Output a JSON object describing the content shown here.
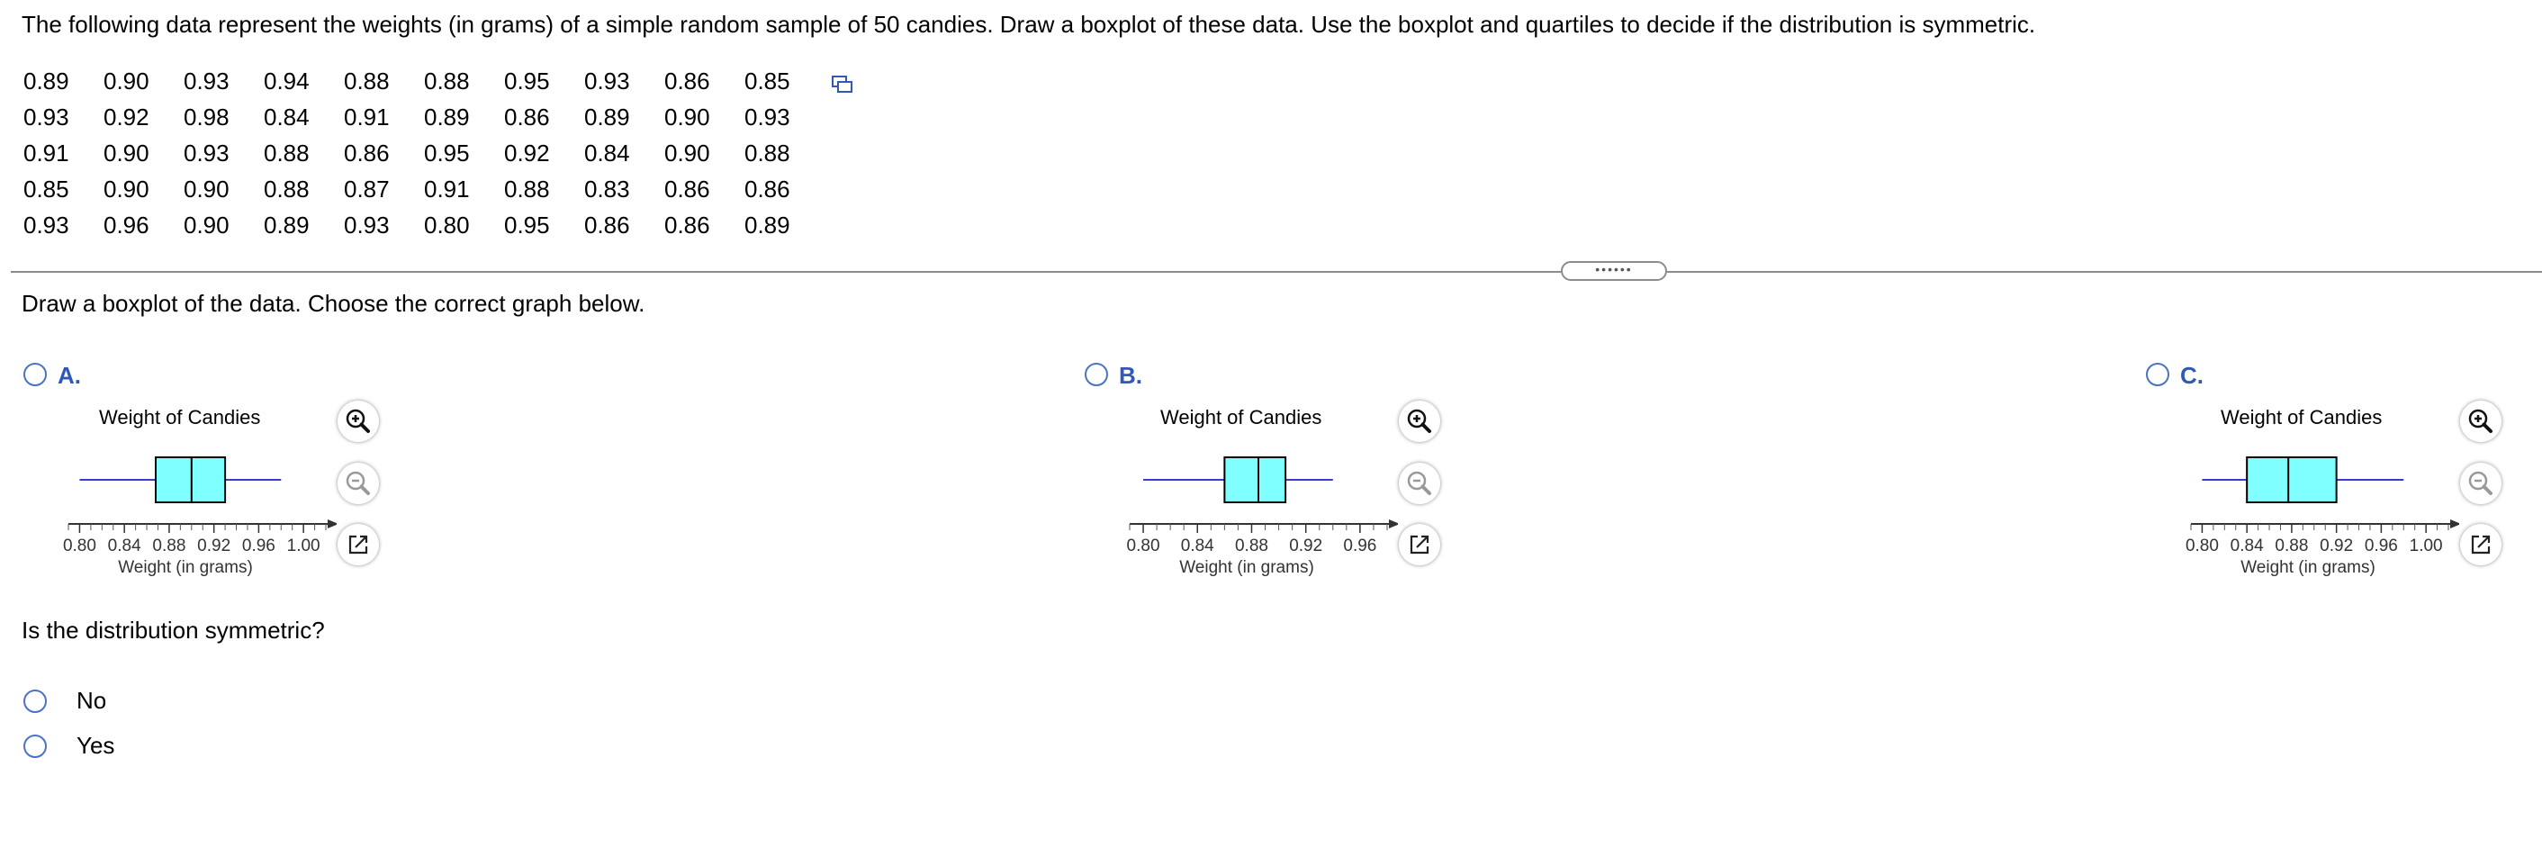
{
  "question_text": "The following data represent the weights (in grams) of a simple random sample of 50 candies. Draw a boxplot of these data. Use the boxplot and quartiles to decide if the distribution is symmetric.",
  "data_table": [
    [
      "0.89",
      "0.90",
      "0.93",
      "0.94",
      "0.88",
      "0.88",
      "0.95",
      "0.93",
      "0.86",
      "0.85"
    ],
    [
      "0.93",
      "0.92",
      "0.98",
      "0.84",
      "0.91",
      "0.89",
      "0.86",
      "0.89",
      "0.90",
      "0.93"
    ],
    [
      "0.91",
      "0.90",
      "0.93",
      "0.88",
      "0.86",
      "0.95",
      "0.92",
      "0.84",
      "0.90",
      "0.88"
    ],
    [
      "0.85",
      "0.90",
      "0.90",
      "0.88",
      "0.87",
      "0.91",
      "0.88",
      "0.83",
      "0.86",
      "0.86"
    ],
    [
      "0.93",
      "0.96",
      "0.90",
      "0.89",
      "0.93",
      "0.80",
      "0.95",
      "0.86",
      "0.86",
      "0.89"
    ]
  ],
  "divider_handle": "••••••",
  "part1_prompt": "Draw a boxplot of the data. Choose the correct graph below.",
  "options": [
    {
      "letter": "A.",
      "title": "Weight of Candies",
      "xlabel": "Weight (in grams)"
    },
    {
      "letter": "B.",
      "title": "Weight of Candies",
      "xlabel": "Weight (in grams)"
    },
    {
      "letter": "C.",
      "title": "Weight of Candies",
      "xlabel": "Weight (in grams)"
    }
  ],
  "chart_data": [
    {
      "type": "boxplot",
      "title": "Weight of Candies",
      "xlabel": "Weight (in grams)",
      "xlim": [
        0.79,
        1.02
      ],
      "ticks": [
        "0.80",
        "0.84",
        "0.88",
        "0.92",
        "0.96",
        "1.00"
      ],
      "min": 0.8,
      "q1": 0.868,
      "median": 0.9,
      "q3": 0.93,
      "max": 0.98
    },
    {
      "type": "boxplot",
      "title": "Weight of Candies",
      "xlabel": "Weight (in grams)",
      "xlim": [
        0.79,
        0.98
      ],
      "ticks": [
        "0.80",
        "0.84",
        "0.88",
        "0.92",
        "0.96"
      ],
      "min": 0.8,
      "q1": 0.86,
      "median": 0.885,
      "q3": 0.905,
      "max": 0.94
    },
    {
      "type": "boxplot",
      "title": "Weight of Candies",
      "xlabel": "Weight (in grams)",
      "xlim": [
        0.79,
        1.02
      ],
      "ticks": [
        "0.80",
        "0.84",
        "0.88",
        "0.92",
        "0.96",
        "1.00"
      ],
      "min": 0.8,
      "q1": 0.84,
      "median": 0.877,
      "q3": 0.92,
      "max": 0.98
    }
  ],
  "box_color": "#7fffff",
  "whisker_color": "#3a3acc",
  "accent_color": "#3158b8",
  "tools": {
    "zoom_in": "zoom-in-icon",
    "zoom_out": "zoom-out-icon",
    "pop_out": "pop-out-icon"
  },
  "part2_prompt": "Is the distribution symmetric?",
  "answers": [
    "No",
    "Yes"
  ]
}
